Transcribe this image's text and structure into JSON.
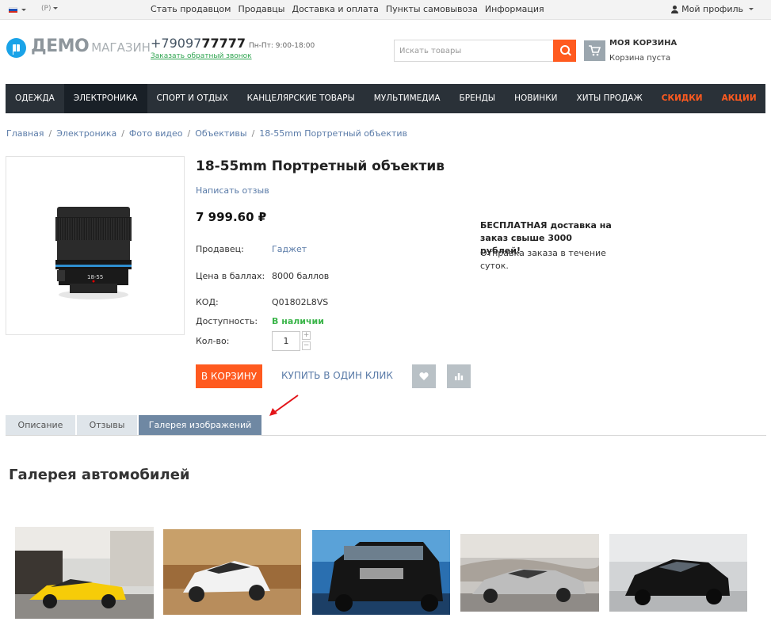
{
  "topbar": {
    "currency": "(Р)",
    "links": [
      "Стать продавцом",
      "Продавцы",
      "Доставка и оплата",
      "Пункты самовывоза",
      "Информация"
    ],
    "profile": "Мой профиль"
  },
  "header": {
    "logo_main": "ДЕМО",
    "logo_sub": "МАГАЗИН",
    "phone_prefix": "+79097",
    "phone_bold": "77777",
    "hours": "Пн-Пт: 9:00-18:00",
    "callback": "Заказать обратный звонок",
    "search_placeholder": "Искать товары",
    "cart_title": "МОЯ КОРЗИНА",
    "cart_status": "Корзина пуста"
  },
  "nav": {
    "items": [
      {
        "label": "ОДЕЖДА"
      },
      {
        "label": "ЭЛЕКТРОНИКА"
      },
      {
        "label": "СПОРТ И ОТДЫХ"
      },
      {
        "label": "КАНЦЕЛЯРСКИЕ ТОВАРЫ"
      },
      {
        "label": "МУЛЬТИМЕДИА"
      },
      {
        "label": "БРЕНДЫ"
      },
      {
        "label": "НОВИНКИ"
      },
      {
        "label": "ХИТЫ ПРОДАЖ"
      },
      {
        "label": "СКИДКИ"
      },
      {
        "label": "АКЦИИ"
      }
    ],
    "accent_color": "#ff5a1f"
  },
  "breadcrumb": [
    "Главная",
    "Электроника",
    "Фото видео",
    "Объективы",
    "18-55mm Портретный объектив"
  ],
  "product": {
    "image_lens_text": "18-55",
    "title": "18-55mm Портретный объектив",
    "review_link": "Написать отзыв",
    "price": "7 999.60 ₽",
    "seller_label": "Продавец:",
    "seller_value": "Гаджет",
    "points_label": "Цена в баллах:",
    "points_value": "8000 баллов",
    "code_label": "КОД:",
    "code_value": "Q01802L8VS",
    "availability_label": "Доступность:",
    "availability_value": "В наличии",
    "qty_label": "Кол-во:",
    "qty_value": "1",
    "qty_plus": "+",
    "qty_minus": "−",
    "add_to_cart": "В КОРЗИНУ",
    "one_click": "КУПИТЬ В ОДИН КЛИК",
    "delivery_bold": "БЕСПЛАТНАЯ доставка на заказ свыше 3000 рублей!",
    "delivery_note": "Отправка заказа в течение суток."
  },
  "tabs": {
    "description": "Описание",
    "reviews": "Отзывы",
    "gallery": "Галерея изображений"
  },
  "gallery": {
    "title": "Галерея автомобилей"
  }
}
